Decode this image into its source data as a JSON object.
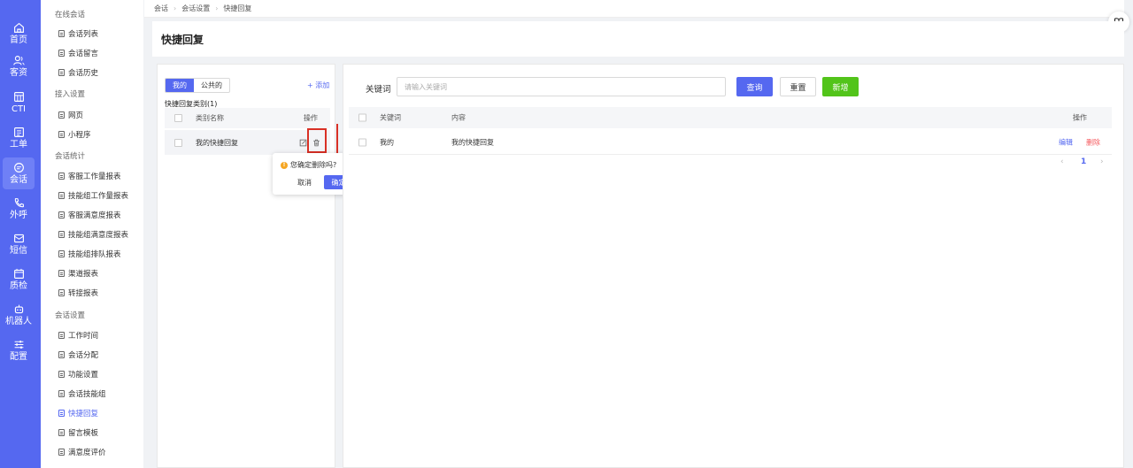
{
  "rail": [
    {
      "label": "首页",
      "icon": "home-icon"
    },
    {
      "label": "客资",
      "icon": "users-icon"
    },
    {
      "label": "CTI",
      "icon": "grid-icon"
    },
    {
      "label": "工单",
      "icon": "ticket-icon"
    },
    {
      "label": "会话",
      "icon": "chat-icon",
      "active": true
    },
    {
      "label": "外呼",
      "icon": "phone-icon"
    },
    {
      "label": "短信",
      "icon": "sms-icon"
    },
    {
      "label": "质检",
      "icon": "calendar-icon"
    },
    {
      "label": "机器人",
      "icon": "robot-icon"
    },
    {
      "label": "配置",
      "icon": "sliders-icon"
    }
  ],
  "submenu": {
    "groups": [
      {
        "title": "在线会话",
        "items": [
          "会话列表",
          "会话留言",
          "会话历史"
        ]
      },
      {
        "title": "接入设置",
        "items": [
          "网页",
          "小程序"
        ]
      },
      {
        "title": "会话统计",
        "items": [
          "客服工作量报表",
          "技能组工作量报表",
          "客服满意度报表",
          "技能组满意度报表",
          "技能组排队报表",
          "渠道报表",
          "转接报表"
        ]
      },
      {
        "title": "会话设置",
        "items": [
          "工作时间",
          "会话分配",
          "功能设置",
          "会话技能组",
          "快捷回复",
          "留言模板",
          "满意度评价"
        ]
      }
    ],
    "active_item": "快捷回复"
  },
  "breadcrumb": [
    "会话",
    "会话设置",
    "快捷回复"
  ],
  "page_title": "快捷回复",
  "left_panel": {
    "tabs": [
      "我的",
      "公共的"
    ],
    "active_tab": "我的",
    "add_label": "+ 添加",
    "category_title": "快捷回复类别(1)",
    "columns": [
      "类别名称",
      "操作"
    ],
    "rows": [
      {
        "name": "我的快捷回复"
      }
    ]
  },
  "popconfirm": {
    "message": "您确定删除吗?",
    "cancel": "取消",
    "ok": "确定"
  },
  "right_panel": {
    "keyword_label": "关键词",
    "keyword_placeholder": "请输入关键词",
    "query_label": "查询",
    "reset_label": "重置",
    "new_label": "新增",
    "columns": [
      "关键词",
      "内容",
      "操作"
    ],
    "rows": [
      {
        "keyword": "我的",
        "content": "我的快捷回复",
        "edit": "编辑",
        "delete": "删除"
      }
    ],
    "page": "1"
  },
  "colors": {
    "primary": "#5568f0",
    "success": "#52c41a",
    "danger": "#f5555a",
    "annotation": "#d93025"
  }
}
